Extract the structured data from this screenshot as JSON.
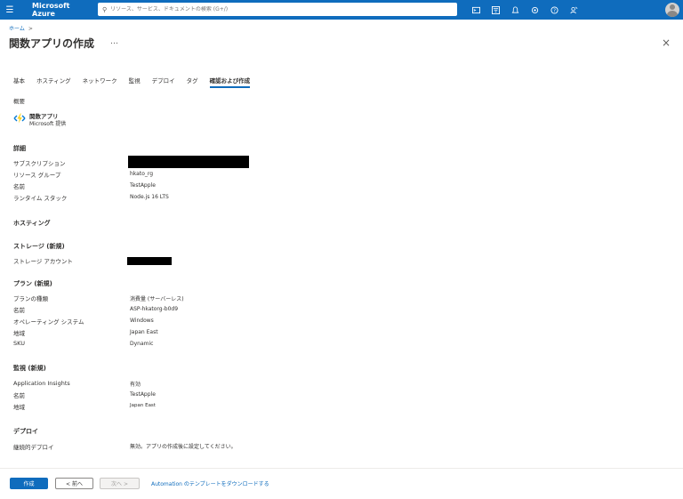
{
  "topbar": {
    "brand": "Microsoft Azure",
    "search_placeholder": "リソース、サービス、ドキュメントの検索 (G+/)",
    "icons": [
      "cloud-shell-icon",
      "directory-filter-icon",
      "notifications-icon",
      "settings-icon",
      "help-icon",
      "feedback-icon"
    ]
  },
  "breadcrumb": {
    "home": "ホーム",
    "sep": ">"
  },
  "page": {
    "title": "関数アプリの作成",
    "more": "…",
    "close": "×"
  },
  "tabs": [
    "基本",
    "ホスティング",
    "ネットワーク",
    "監視",
    "デプロイ",
    "タグ",
    "確認および作成"
  ],
  "summary": {
    "heading": "概要",
    "product": "関数アプリ",
    "provider": "Microsoft 提供"
  },
  "details": {
    "heading": "詳細",
    "rows": [
      {
        "label": "サブスクリプション",
        "value": ""
      },
      {
        "label": "リソース グループ",
        "value": "hkato_rg"
      },
      {
        "label": "名前",
        "value": "TestApple"
      },
      {
        "label": "ランタイム スタック",
        "value": "Node.js 16 LTS"
      }
    ]
  },
  "hosting": {
    "heading": "ホスティング"
  },
  "storage": {
    "heading": "ストレージ (新規)",
    "rows": [
      {
        "label": "ストレージ アカウント",
        "value": ""
      }
    ]
  },
  "plan": {
    "heading": "プラン (新規)",
    "rows": [
      {
        "label": "プランの種類",
        "value": "消費量 (サーバーレス)"
      },
      {
        "label": "名前",
        "value": "ASP-hkatorg-b0d9"
      },
      {
        "label": "オペレーティング システム",
        "value": "Windows"
      },
      {
        "label": "地域",
        "value": "Japan East"
      },
      {
        "label": "SKU",
        "value": "Dynamic"
      }
    ]
  },
  "monitoring": {
    "heading": "監視 (新規)",
    "rows": [
      {
        "label": "Application Insights",
        "value": "有効"
      },
      {
        "label": "名前",
        "value": "TestApple"
      },
      {
        "label": "地域",
        "value": "Japan East"
      }
    ]
  },
  "deploy": {
    "heading": "デプロイ",
    "rows": [
      {
        "label": "継続的デプロイ",
        "value": "無効。アプリの作成後に設定してください。"
      }
    ]
  },
  "footer": {
    "create": "作成",
    "prev": "< 前へ",
    "next": "次へ >",
    "download": "Automation のテンプレートをダウンロードする"
  },
  "colors": {
    "accent": "#0f6cbd",
    "text": "#323130",
    "muted": "#605e5c"
  }
}
